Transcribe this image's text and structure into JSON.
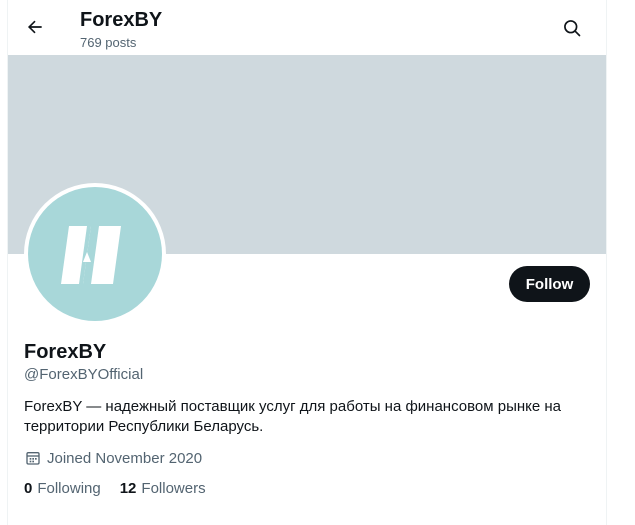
{
  "header": {
    "title": "ForexBY",
    "posts_count": "769 posts",
    "back_icon": "arrow-left-icon",
    "search_icon": "search-icon"
  },
  "profile": {
    "display_name": "ForexBY",
    "handle": "@ForexBYOfficial",
    "bio": "ForexBY — надежный поставщик услуг для работы на финансовом рынке на территории Республики Беларусь.",
    "joined": "Joined November 2020",
    "follow_label": "Follow",
    "following_count": "0",
    "following_label": "Following",
    "followers_count": "12",
    "followers_label": "Followers"
  },
  "colors": {
    "banner": "#cfd9de",
    "avatar_bg": "#a8d7d9",
    "follow_bg": "#0f1419",
    "secondary_text": "#536471"
  }
}
